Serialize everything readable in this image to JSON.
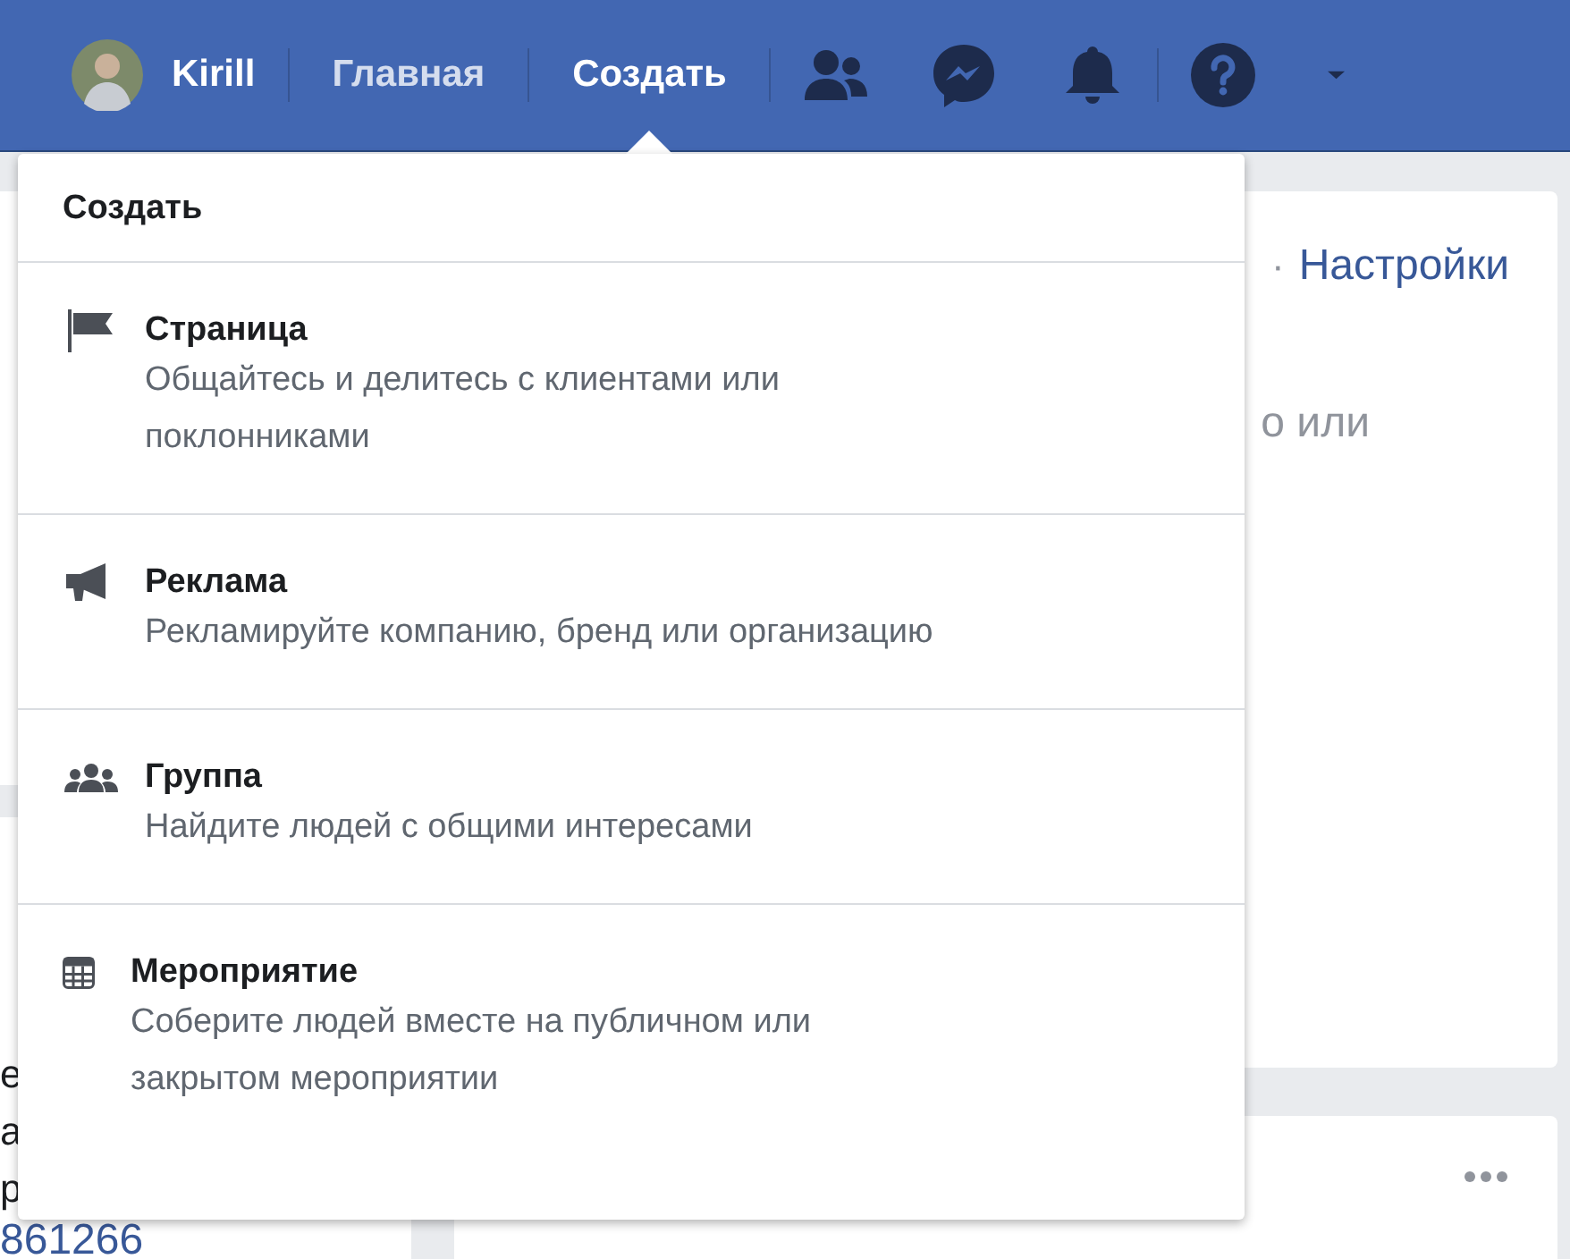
{
  "navbar": {
    "user": "Kirill",
    "items": [
      {
        "label": "Главная",
        "selected": false
      },
      {
        "label": "Создать",
        "selected": true
      }
    ]
  },
  "create_menu": {
    "title": "Создать",
    "items": [
      {
        "kind": "flag",
        "title": "Страница",
        "description": "Общайтесь и делитесь с клиентами или поклонниками"
      },
      {
        "kind": "megaphone",
        "title": "Реклама",
        "description": "Рекламируйте компанию, бренд или организацию"
      },
      {
        "kind": "people",
        "title": "Группа",
        "description": "Найдите людей с общими интересами"
      },
      {
        "kind": "calendar",
        "title": "Мероприятие",
        "description": "Соберите людей вместе на публичном или закрытом мероприятии"
      }
    ]
  },
  "left_column": {
    "fragments": [
      "е",
      "а",
      "р"
    ],
    "bottom_link": "861266"
  },
  "right_card": {
    "separator": "·",
    "link": "Настройки",
    "text": "о или"
  }
}
